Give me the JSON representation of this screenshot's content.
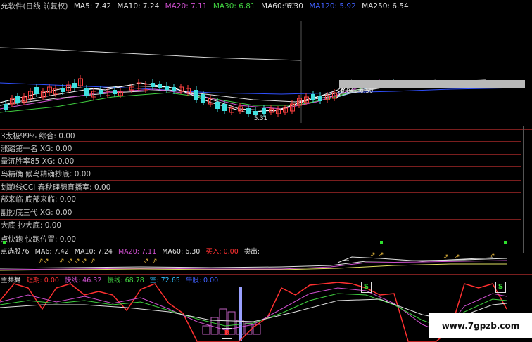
{
  "header": {
    "title": "允软件(日线 前复权)",
    "ma": [
      {
        "label": "MA5: 7.42",
        "color": "#e0e0e0"
      },
      {
        "label": "MA10: 7.24",
        "color": "#e0e0e0"
      },
      {
        "label": "MA20: 7.11",
        "color": "#d050d0"
      },
      {
        "label": "MA30: 6.81",
        "color": "#40d040"
      },
      {
        "label": "MA60: 6.30",
        "color": "#e0e0e0"
      },
      {
        "label": "MA120: 5.92",
        "color": "#4060ff"
      },
      {
        "label": "MA250: 6.54",
        "color": "#e0e0e0"
      }
    ],
    "corner_icons": "▫ ▫"
  },
  "price_annotations": {
    "low": "5.31",
    "target": "6.04 - 6.50"
  },
  "panels": [
    {
      "name": "太极",
      "text": "3太极99%  综合: 0.00"
    },
    {
      "name": "第一名",
      "text": "涨踏第一名 XG: 0.00"
    },
    {
      "name": "胜率",
      "text": "量沉胜率85 XG: 0.00"
    },
    {
      "name": "鸟精确",
      "text": "鸟精确  候鸟精确抄底: 0.00"
    },
    {
      "name": "CCI",
      "text": "划跑线CCI  春秋理想直播室: 0.00"
    },
    {
      "name": "底部",
      "text": "部来临  底部来临: 0.00"
    },
    {
      "name": "三代",
      "text": "副抄底三代 XG: 0.00"
    },
    {
      "name": "抄大底",
      "text": "大底  抄大底: 0.00"
    },
    {
      "name": "快跑",
      "text": "点快跑  快跑位置: 0.00"
    }
  ],
  "ma6_bar": [
    {
      "label": "点选股76",
      "color": "#e0e0e0"
    },
    {
      "label": "MA6: 7.42",
      "color": "#e0e0e0"
    },
    {
      "label": "MA10: 7.24",
      "color": "#e0e0e0"
    },
    {
      "label": "MA20: 7.11",
      "color": "#d050d0"
    },
    {
      "label": "MA60: 6.30",
      "color": "#e0e0e0"
    },
    {
      "label": "买入: 0.00",
      "color": "#ff3030"
    },
    {
      "label": "卖出:",
      "color": "#e0e0e0"
    }
  ],
  "kdj_bar": [
    {
      "label": "主共舞",
      "color": "#e0e0e0"
    },
    {
      "label": "短期: 0.00",
      "color": "#ff3030"
    },
    {
      "label": "快线: 46.32",
      "color": "#d050d0"
    },
    {
      "label": "慢线: 68.78",
      "color": "#40d040"
    },
    {
      "label": "空: 72.65",
      "color": "#30c0ff"
    },
    {
      "label": "牛股: 0.00",
      "color": "#4060ff"
    }
  ],
  "signals": {
    "buy": "B",
    "sell": "S"
  },
  "watermark": "www.7gpzb.com"
}
